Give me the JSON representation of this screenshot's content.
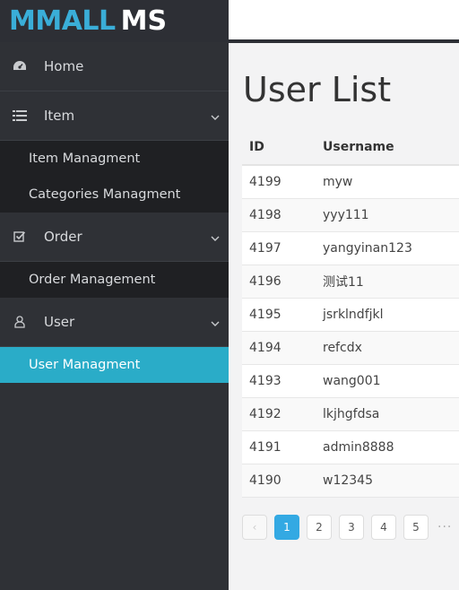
{
  "brand": {
    "main": "MMALL",
    "sub": "MS"
  },
  "sidebar": {
    "home": {
      "label": "Home",
      "icon": "dashboard-icon"
    },
    "item": {
      "label": "Item",
      "icon": "list-icon",
      "children": [
        "Item Managment",
        "Categories Managment"
      ]
    },
    "order": {
      "label": "Order",
      "icon": "check-square-icon",
      "children": [
        "Order Management"
      ]
    },
    "user": {
      "label": "User",
      "icon": "user-icon",
      "children": [
        "User Managment"
      ]
    }
  },
  "main": {
    "title": "User List",
    "columns": [
      "ID",
      "Username"
    ],
    "rows": [
      [
        "4199",
        "myw"
      ],
      [
        "4198",
        "yyy111"
      ],
      [
        "4197",
        "yangyinan123"
      ],
      [
        "4196",
        "测试11"
      ],
      [
        "4195",
        "jsrklndfjkl"
      ],
      [
        "4194",
        "refcdx"
      ],
      [
        "4193",
        "wang001"
      ],
      [
        "4192",
        "lkjhgfdsa"
      ],
      [
        "4191",
        "admin8888"
      ],
      [
        "4190",
        "w12345"
      ]
    ],
    "pagination": {
      "prev": "‹",
      "pages": [
        "1",
        "2",
        "3",
        "4",
        "5"
      ],
      "current": "1",
      "more": "···"
    }
  },
  "colors": {
    "accent": "#2aacc8",
    "brand": "#3aaed8",
    "sidebar": "#2f3136",
    "page_active": "#33a9e3"
  }
}
